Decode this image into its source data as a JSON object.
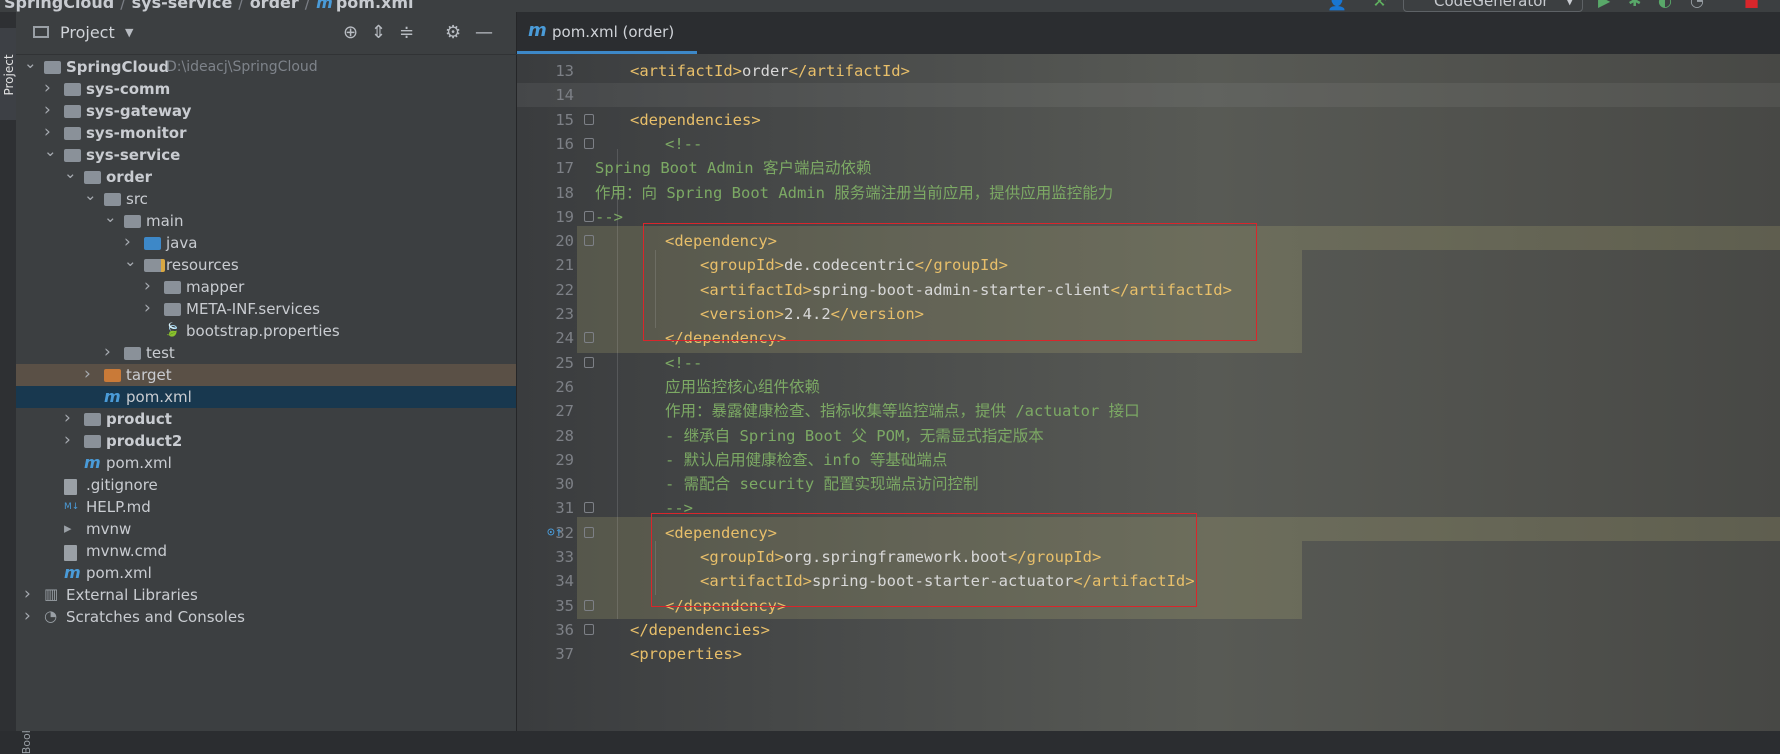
{
  "breadcrumb": [
    "SpringCloud",
    "sys-service",
    "order",
    "pom.xml"
  ],
  "toolbar": {
    "run_config": "CodeGenerator"
  },
  "left_strip": {
    "project_tab": "Project",
    "bookmarks_tab": "Bookmarks"
  },
  "project_panel": {
    "title": "Project",
    "tree": [
      {
        "label": "SpringCloud",
        "hint": "D:\\ideacj\\SpringCloud",
        "depth": 0,
        "expanded": true,
        "icon": "folder-icon",
        "bold": true
      },
      {
        "label": "sys-comm",
        "depth": 1,
        "expanded": false,
        "icon": "folder-icon",
        "bold": true
      },
      {
        "label": "sys-gateway",
        "depth": 1,
        "expanded": false,
        "icon": "folder-icon",
        "bold": true
      },
      {
        "label": "sys-monitor",
        "depth": 1,
        "expanded": false,
        "icon": "folder-icon",
        "bold": true
      },
      {
        "label": "sys-service",
        "depth": 1,
        "expanded": true,
        "icon": "folder-icon",
        "bold": true
      },
      {
        "label": "order",
        "depth": 2,
        "expanded": true,
        "icon": "folder-icon",
        "bold": true
      },
      {
        "label": "src",
        "depth": 3,
        "expanded": true,
        "icon": "folder-icon"
      },
      {
        "label": "main",
        "depth": 4,
        "expanded": true,
        "icon": "folder-icon"
      },
      {
        "label": "java",
        "depth": 5,
        "expanded": false,
        "icon": "java-folder-icon"
      },
      {
        "label": "resources",
        "depth": 5,
        "expanded": true,
        "icon": "resources-folder-icon"
      },
      {
        "label": "mapper",
        "depth": 6,
        "expanded": false,
        "icon": "folder-icon"
      },
      {
        "label": "META-INF.services",
        "depth": 6,
        "expanded": false,
        "icon": "folder-icon"
      },
      {
        "label": "bootstrap.properties",
        "depth": 6,
        "leaf": true,
        "icon": "spring-properties-icon"
      },
      {
        "label": "test",
        "depth": 4,
        "expanded": false,
        "icon": "folder-icon"
      },
      {
        "label": "target",
        "depth": 3,
        "expanded": false,
        "icon": "excluded-folder-icon",
        "state": "target"
      },
      {
        "label": "pom.xml",
        "depth": 3,
        "leaf": true,
        "icon": "maven-icon",
        "state": "selected"
      },
      {
        "label": "product",
        "depth": 2,
        "expanded": false,
        "icon": "folder-icon",
        "bold": true
      },
      {
        "label": "product2",
        "depth": 2,
        "expanded": false,
        "icon": "folder-icon",
        "bold": true
      },
      {
        "label": "pom.xml",
        "depth": 2,
        "leaf": true,
        "icon": "maven-icon"
      },
      {
        "label": ".gitignore",
        "depth": 1,
        "leaf": true,
        "icon": "file-icon"
      },
      {
        "label": "HELP.md",
        "depth": 1,
        "leaf": true,
        "icon": "markdown-icon"
      },
      {
        "label": "mvnw",
        "depth": 1,
        "leaf": true,
        "icon": "terminal-file-icon"
      },
      {
        "label": "mvnw.cmd",
        "depth": 1,
        "leaf": true,
        "icon": "file-icon"
      },
      {
        "label": "pom.xml",
        "depth": 1,
        "leaf": true,
        "icon": "maven-icon"
      },
      {
        "label": "External Libraries",
        "depth": 0,
        "expanded": false,
        "icon": "libraries-icon"
      },
      {
        "label": "Scratches and Consoles",
        "depth": 0,
        "expanded": false,
        "icon": "scratches-icon"
      }
    ]
  },
  "editor": {
    "tab_label": "pom.xml (order)",
    "lines": [
      {
        "n": 13,
        "indent": 1,
        "parts": [
          [
            "tg",
            "<artifactId>"
          ],
          [
            "tx",
            "order"
          ],
          [
            "tg",
            "</artifactId>"
          ]
        ]
      },
      {
        "n": 14,
        "indent": 0,
        "parts": [],
        "caret": true
      },
      {
        "n": 15,
        "indent": 1,
        "parts": [
          [
            "tg",
            "<dependencies>"
          ]
        ],
        "fold": true
      },
      {
        "n": 16,
        "indent": 2,
        "parts": [
          [
            "cm",
            "<!--"
          ]
        ],
        "fold": true
      },
      {
        "n": 17,
        "indent": 0,
        "parts": [
          [
            "cm",
            "Spring Boot Admin 客户端启动依赖"
          ]
        ]
      },
      {
        "n": 18,
        "indent": 0,
        "parts": [
          [
            "cm",
            "作用：向 Spring Boot Admin 服务端注册当前应用，提供应用监控能力"
          ]
        ]
      },
      {
        "n": 19,
        "indent": 0,
        "parts": [
          [
            "cm",
            "-->"
          ]
        ],
        "fold": true
      },
      {
        "n": 20,
        "indent": 2,
        "parts": [
          [
            "tg",
            "<dependency>"
          ]
        ],
        "fold": true
      },
      {
        "n": 21,
        "indent": 3,
        "parts": [
          [
            "tg",
            "<groupId>"
          ],
          [
            "tx",
            "de.codecentric"
          ],
          [
            "tg",
            "</groupId>"
          ]
        ]
      },
      {
        "n": 22,
        "indent": 3,
        "parts": [
          [
            "tg",
            "<artifactId>"
          ],
          [
            "tx",
            "spring-boot-admin-starter-client"
          ],
          [
            "tg",
            "</artifactId>"
          ]
        ]
      },
      {
        "n": 23,
        "indent": 3,
        "parts": [
          [
            "tg",
            "<version>"
          ],
          [
            "tx",
            "2.4.2"
          ],
          [
            "tg",
            "</version>"
          ]
        ]
      },
      {
        "n": 24,
        "indent": 2,
        "parts": [
          [
            "tg",
            "</dependency>"
          ]
        ],
        "fold": true
      },
      {
        "n": 25,
        "indent": 2,
        "parts": [
          [
            "cm",
            "<!--"
          ]
        ],
        "fold": true
      },
      {
        "n": 26,
        "indent": 2,
        "parts": [
          [
            "cm",
            "应用监控核心组件依赖"
          ]
        ]
      },
      {
        "n": 27,
        "indent": 2,
        "parts": [
          [
            "cm",
            "作用：暴露健康检查、指标收集等监控端点，提供 /actuator 接口"
          ]
        ]
      },
      {
        "n": 28,
        "indent": 2,
        "parts": [
          [
            "cm",
            "- 继承自 Spring Boot 父 POM，无需显式指定版本"
          ]
        ]
      },
      {
        "n": 29,
        "indent": 2,
        "parts": [
          [
            "cm",
            "- 默认启用健康检查、info 等基础端点"
          ]
        ]
      },
      {
        "n": 30,
        "indent": 2,
        "parts": [
          [
            "cm",
            "- 需配合 security 配置实现端点访问控制"
          ]
        ]
      },
      {
        "n": 31,
        "indent": 2,
        "parts": [
          [
            "cm",
            "-->"
          ]
        ],
        "fold": true
      },
      {
        "n": 32,
        "indent": 2,
        "parts": [
          [
            "tg",
            "<dependency>"
          ]
        ],
        "fold": true,
        "marker": true
      },
      {
        "n": 33,
        "indent": 3,
        "parts": [
          [
            "tg",
            "<groupId>"
          ],
          [
            "tx",
            "org.springframework.boot"
          ],
          [
            "tg",
            "</groupId>"
          ]
        ]
      },
      {
        "n": 34,
        "indent": 3,
        "parts": [
          [
            "tg",
            "<artifactId>"
          ],
          [
            "tx",
            "spring-boot-starter-actuator"
          ],
          [
            "tg",
            "</artifactId>"
          ]
        ]
      },
      {
        "n": 35,
        "indent": 2,
        "parts": [
          [
            "tg",
            "</dependency>"
          ]
        ],
        "fold": true
      },
      {
        "n": 36,
        "indent": 1,
        "parts": [
          [
            "tg",
            "</dependencies>"
          ]
        ],
        "fold": true
      },
      {
        "n": 37,
        "indent": 1,
        "parts": [
          [
            "tg",
            "<properties>"
          ]
        ]
      }
    ]
  }
}
